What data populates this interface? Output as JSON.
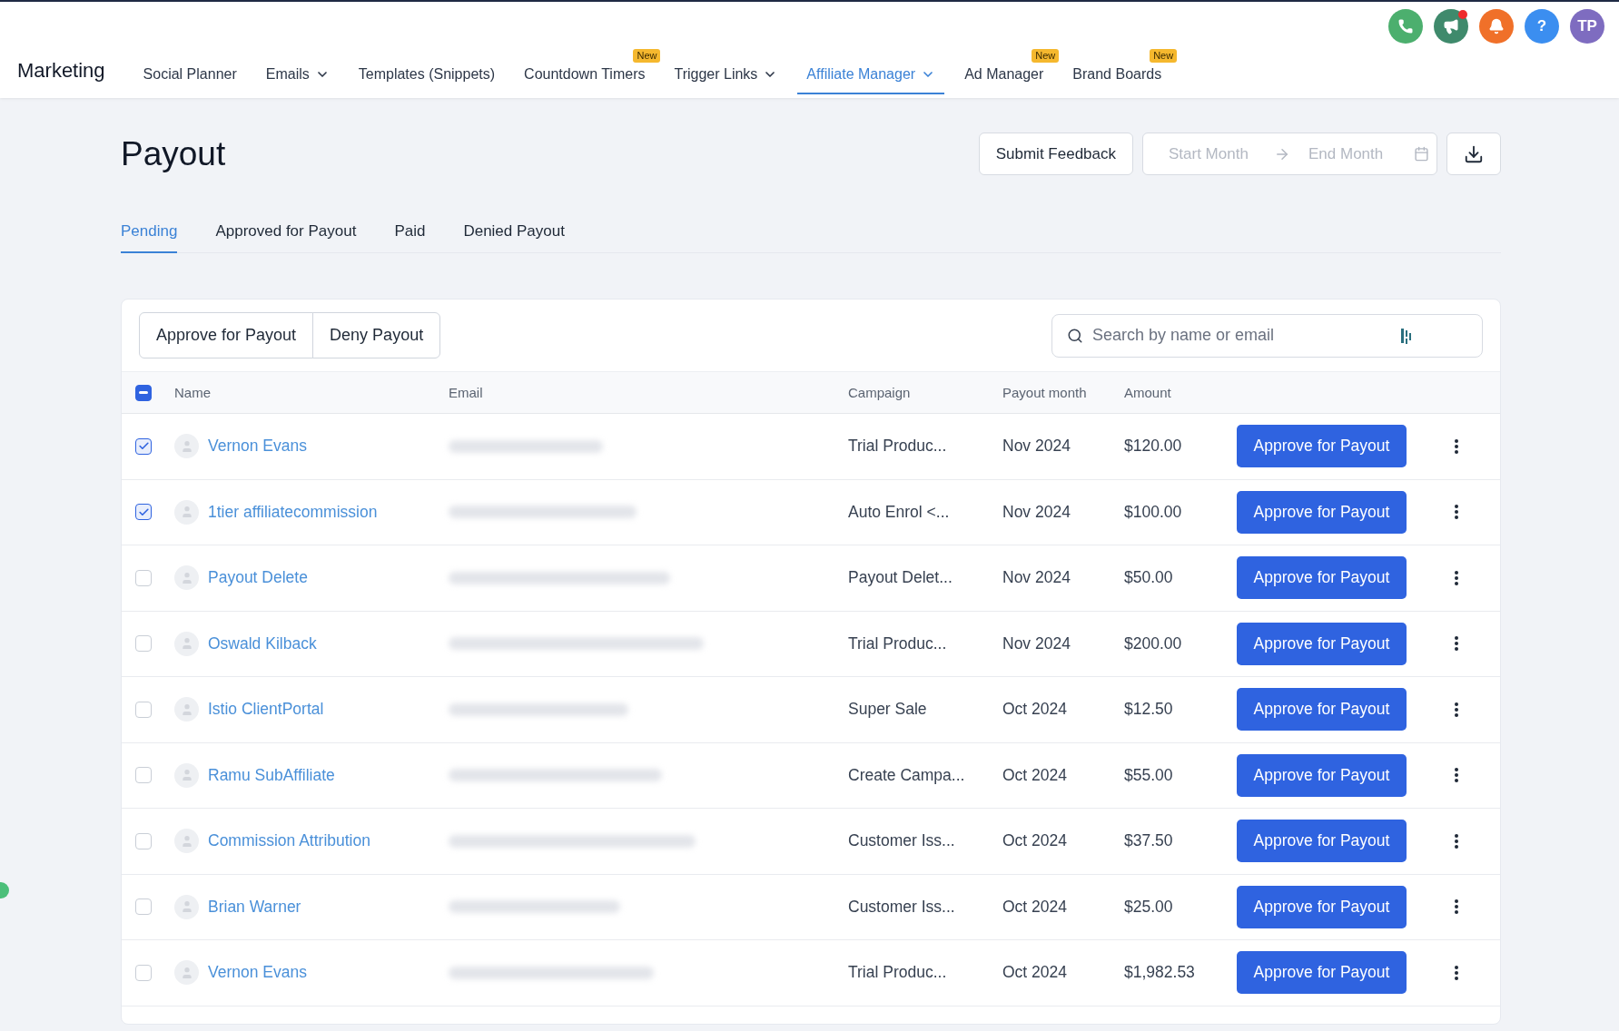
{
  "app": {
    "title": "Marketing"
  },
  "nav": [
    {
      "label": "Social Planner",
      "dropdown": false,
      "selected": false
    },
    {
      "label": "Emails",
      "dropdown": true,
      "selected": false
    },
    {
      "label": "Templates (Snippets)",
      "dropdown": false,
      "selected": false
    },
    {
      "label": "Countdown Timers",
      "dropdown": false,
      "selected": false,
      "badge": "New"
    },
    {
      "label": "Trigger Links",
      "dropdown": true,
      "selected": false
    },
    {
      "label": "Affiliate Manager",
      "dropdown": true,
      "selected": true
    },
    {
      "label": "Ad Manager",
      "dropdown": false,
      "selected": false,
      "badge": "New"
    },
    {
      "label": "Brand Boards",
      "dropdown": false,
      "selected": false,
      "badge": "New"
    }
  ],
  "top_icons": [
    {
      "kind": "phone",
      "color": "#4caf6e",
      "dot": false
    },
    {
      "kind": "megaphone",
      "color": "#3f8a6c",
      "dot": true
    },
    {
      "kind": "bell",
      "color": "#f07029",
      "dot": false
    },
    {
      "kind": "help",
      "color": "#3b8ef0",
      "dot": false,
      "text": "?"
    },
    {
      "kind": "avatar",
      "color": "#7e6cc0",
      "dot": false,
      "text": "TP"
    }
  ],
  "page": {
    "title": "Payout",
    "feedback_button": "Submit Feedback",
    "date_range": {
      "start_placeholder": "Start Month",
      "end_placeholder": "End Month"
    }
  },
  "tabs": [
    {
      "label": "Pending",
      "selected": true
    },
    {
      "label": "Approved for Payout",
      "selected": false
    },
    {
      "label": "Paid",
      "selected": false
    },
    {
      "label": "Denied Payout",
      "selected": false
    }
  ],
  "bulk_actions": [
    "Approve for Payout",
    "Deny Payout"
  ],
  "search": {
    "placeholder": "Search by name or email"
  },
  "table": {
    "select_all_indeterminate": true,
    "columns": [
      "Name",
      "Email",
      "Campaign",
      "Payout month",
      "Amount"
    ],
    "rows": [
      {
        "selected": true,
        "name": "Vernon Evans",
        "campaign": "Trial Produc...",
        "month": "Nov 2024",
        "amount": "$120.00",
        "action": "Approve for Payout"
      },
      {
        "selected": true,
        "name": "1tier affiliatecommission",
        "campaign": "Auto Enrol <...",
        "month": "Nov 2024",
        "amount": "$100.00",
        "action": "Approve for Payout"
      },
      {
        "selected": false,
        "name": "Payout Delete",
        "campaign": "Payout Delet...",
        "month": "Nov 2024",
        "amount": "$50.00",
        "action": "Approve for Payout"
      },
      {
        "selected": false,
        "name": "Oswald Kilback",
        "campaign": "Trial Produc...",
        "month": "Nov 2024",
        "amount": "$200.00",
        "action": "Approve for Payout"
      },
      {
        "selected": false,
        "name": "Istio ClientPortal",
        "campaign": "Super Sale",
        "month": "Oct 2024",
        "amount": "$12.50",
        "action": "Approve for Payout"
      },
      {
        "selected": false,
        "name": "Ramu SubAffiliate",
        "campaign": "Create Campa...",
        "month": "Oct 2024",
        "amount": "$55.00",
        "action": "Approve for Payout"
      },
      {
        "selected": false,
        "name": "Commission Attribution",
        "campaign": "Customer Iss...",
        "month": "Oct 2024",
        "amount": "$37.50",
        "action": "Approve for Payout"
      },
      {
        "selected": false,
        "name": "Brian Warner",
        "campaign": "Customer Iss...",
        "month": "Oct 2024",
        "amount": "$25.00",
        "action": "Approve for Payout"
      },
      {
        "selected": false,
        "name": "Vernon Evans",
        "campaign": "Trial Produc...",
        "month": "Oct 2024",
        "amount": "$1,982.53",
        "action": "Approve for Payout"
      }
    ]
  }
}
